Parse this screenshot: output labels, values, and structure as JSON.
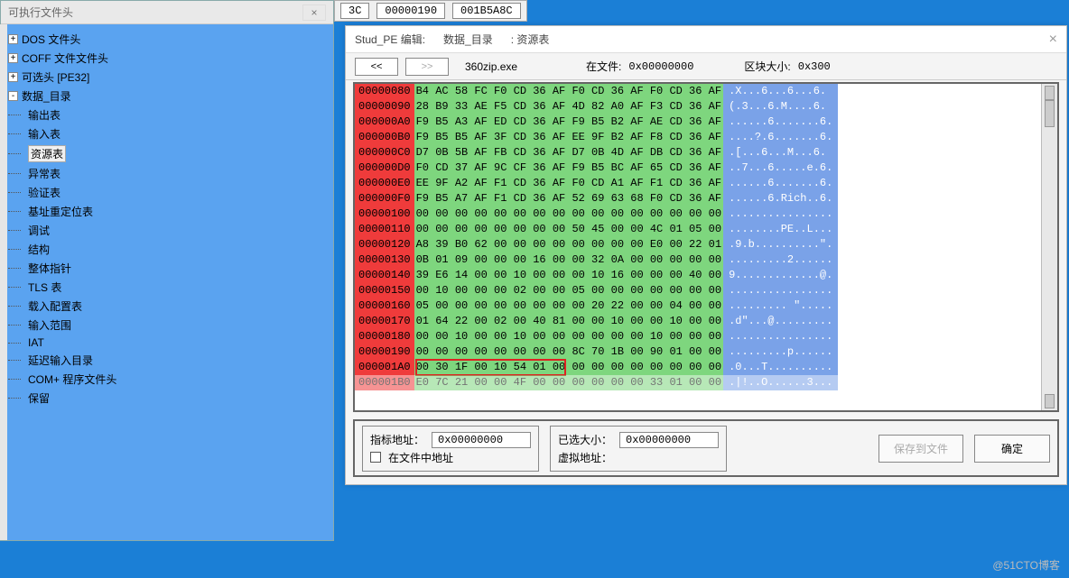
{
  "tree": {
    "title": "可执行文件头",
    "nodes": [
      {
        "label": "DOS 文件头",
        "expand": "+"
      },
      {
        "label": "COFF 文件文件头",
        "expand": "+"
      },
      {
        "label": "可选头 [PE32]",
        "expand": "+"
      },
      {
        "label": "数据_目录",
        "expand": "-",
        "children": [
          "输出表",
          "输入表",
          "资源表",
          "异常表",
          "验证表",
          "基址重定位表",
          "调试",
          "结构",
          "整体指针",
          "TLS 表",
          "载入配置表",
          "输入范围",
          "IAT",
          "延迟输入目录",
          "COM+ 程序文件头",
          "保留"
        ],
        "selectedIndex": 2
      }
    ]
  },
  "topfrag": {
    "c0": "3C",
    "c1": "00000190",
    "c2": "001B5A8C"
  },
  "editor": {
    "title_prefix": "Stud_PE 编辑:",
    "title_mid": "数据_目录",
    "title_suffix": ": 资源表",
    "nav_prev": "<<",
    "nav_next": ">>",
    "filename": "360zip.exe",
    "in_file_label": "在文件:",
    "in_file_value": "0x00000000",
    "block_label": "区块大小:",
    "block_value": "0x300"
  },
  "hex": {
    "rows": [
      {
        "addr": "00000080",
        "hex": "B4 AC 58 FC F0 CD 36 AF F0 CD 36 AF F0 CD 36 AF",
        "asc": ".X...6...6...6."
      },
      {
        "addr": "00000090",
        "hex": "28 B9 33 AE F5 CD 36 AF 4D 82 A0 AF F3 CD 36 AF",
        "asc": "(.3...6.M....6."
      },
      {
        "addr": "000000A0",
        "hex": "F9 B5 A3 AF ED CD 36 AF F9 B5 B2 AF AE CD 36 AF",
        "asc": "......6.......6."
      },
      {
        "addr": "000000B0",
        "hex": "F9 B5 B5 AF 3F CD 36 AF EE 9F B2 AF F8 CD 36 AF",
        "asc": "....?.6.......6."
      },
      {
        "addr": "000000C0",
        "hex": "D7 0B 5B AF FB CD 36 AF D7 0B 4D AF DB CD 36 AF",
        "asc": ".[...6...M...6."
      },
      {
        "addr": "000000D0",
        "hex": "F0 CD 37 AF 9C CF 36 AF F9 B5 BC AF 65 CD 36 AF",
        "asc": "..7...6.....e.6."
      },
      {
        "addr": "000000E0",
        "hex": "EE 9F A2 AF F1 CD 36 AF F0 CD A1 AF F1 CD 36 AF",
        "asc": "......6.......6."
      },
      {
        "addr": "000000F0",
        "hex": "F9 B5 A7 AF F1 CD 36 AF 52 69 63 68 F0 CD 36 AF",
        "asc": "......6.Rich..6."
      },
      {
        "addr": "00000100",
        "hex": "00 00 00 00 00 00 00 00 00 00 00 00 00 00 00 00",
        "asc": "................"
      },
      {
        "addr": "00000110",
        "hex": "00 00 00 00 00 00 00 00 50 45 00 00 4C 01 05 00",
        "asc": "........PE..L..."
      },
      {
        "addr": "00000120",
        "hex": "A8 39 B0 62 00 00 00 00 00 00 00 00 E0 00 22 01",
        "asc": ".9.b..........\"."
      },
      {
        "addr": "00000130",
        "hex": "0B 01 09 00 00 00 16 00 00 32 0A 00 00 00 00 00",
        "asc": ".........2......"
      },
      {
        "addr": "00000140",
        "hex": "39 E6 14 00 00 10 00 00 00 10 16 00 00 00 40 00",
        "asc": "9.............@."
      },
      {
        "addr": "00000150",
        "hex": "00 10 00 00 00 02 00 00 05 00 00 00 00 00 00 00",
        "asc": "................"
      },
      {
        "addr": "00000160",
        "hex": "05 00 00 00 00 00 00 00 00 20 22 00 00 04 00 00",
        "asc": "......... \"....."
      },
      {
        "addr": "00000170",
        "hex": "01 64 22 00 02 00 40 81 00 00 10 00 00 10 00 00",
        "asc": ".d\"...@........."
      },
      {
        "addr": "00000180",
        "hex": "00 00 10 00 00 10 00 00 00 00 00 00 10 00 00 00",
        "asc": "................"
      },
      {
        "addr": "00000190",
        "hex": "00 00 00 00 00 00 00 00 8C 70 1B 00 90 01 00 00",
        "asc": ".........p......"
      },
      {
        "addr": "000001A0",
        "hex": "00 30 1F 00 10 54 01 00",
        "hex2": " 00 00 00 00 00 00 00 00",
        "asc": ".0...T..........",
        "hl": true
      },
      {
        "addr": "000001B0",
        "hex": "E0 7C 21 00 00 4F 00 00 00 00 00 00 33 01 00 00",
        "asc": ".|!..O......3...",
        "faded": true
      }
    ]
  },
  "bottom": {
    "ptr_label": "指标地址：",
    "ptr_value": "0x00000000",
    "chk_label": "在文件中地址",
    "sel_label": "已选大小：",
    "sel_value": "0x00000000",
    "virt_label": "虚拟地址：",
    "save_btn": "保存到文件",
    "ok_btn": "确定"
  },
  "watermark": "@51CTO博客"
}
